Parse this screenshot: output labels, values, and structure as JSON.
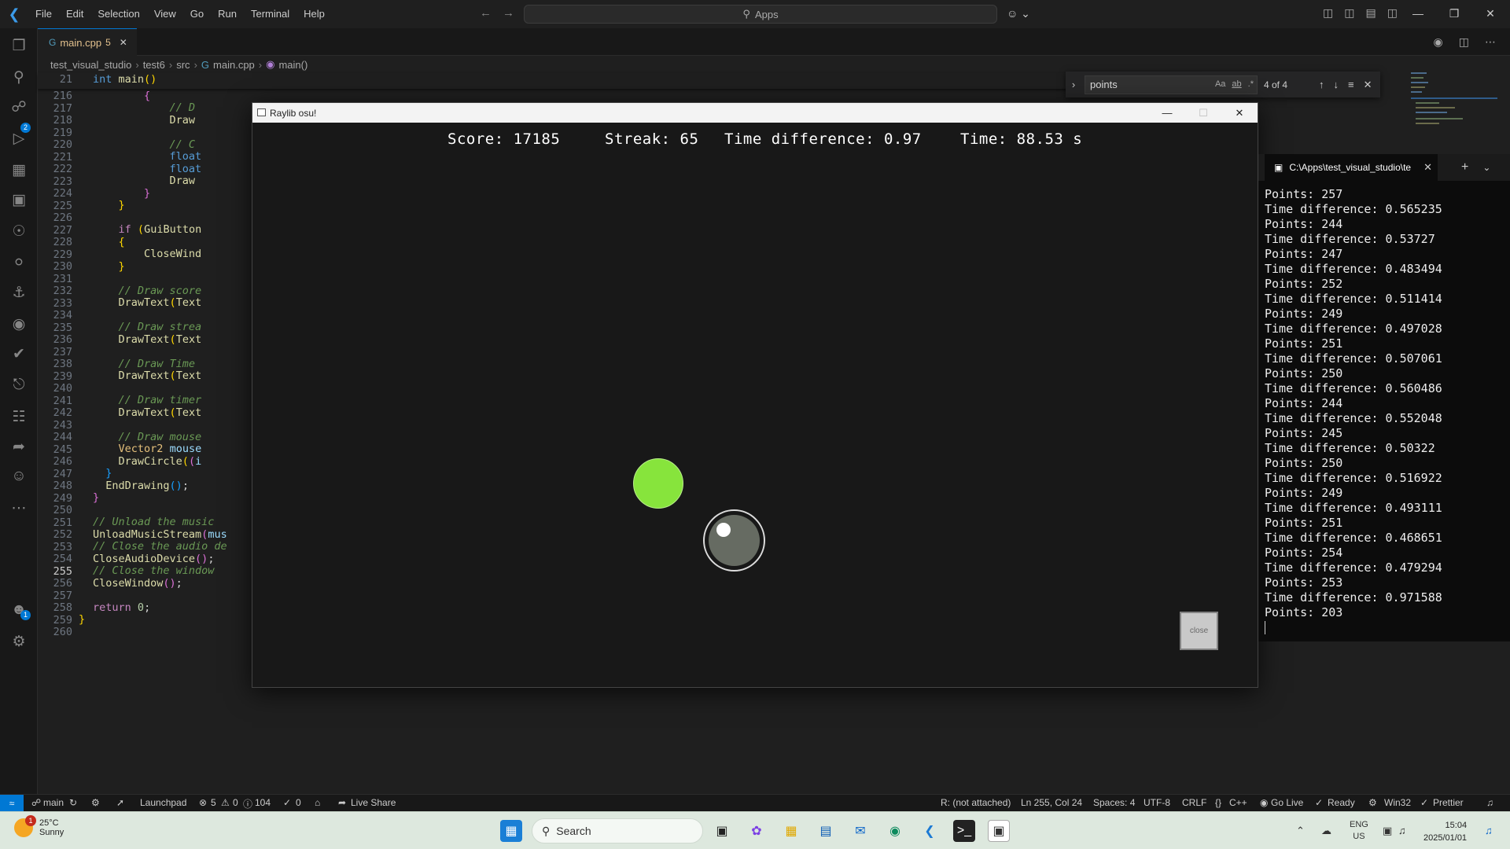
{
  "titlebar": {
    "menu": [
      "File",
      "Edit",
      "Selection",
      "View",
      "Go",
      "Run",
      "Terminal",
      "Help"
    ],
    "search_text": "Apps"
  },
  "activity": {
    "source_control_badge": "2",
    "accounts_badge": "1"
  },
  "tab": {
    "filename": "main.cpp",
    "problems_count": "5"
  },
  "breadcrumb": [
    "test_visual_studio",
    "test6",
    "src",
    "main.cpp",
    "main()"
  ],
  "sticky": {
    "line": "21",
    "code_kw": "int",
    "code_fn": "main",
    "code_rest": "()"
  },
  "editor_lines": [
    "216",
    "217",
    "218",
    "219",
    "220",
    "221",
    "222",
    "223",
    "224",
    "225",
    "226",
    "227",
    "228",
    "229",
    "230",
    "231",
    "232",
    "233",
    "234",
    "235",
    "236",
    "237",
    "238",
    "239",
    "240",
    "241",
    "242",
    "243",
    "244",
    "245",
    "246",
    "247",
    "248",
    "249",
    "250",
    "251",
    "252",
    "253",
    "254",
    "255",
    "256",
    "257",
    "258",
    "259",
    "260"
  ],
  "current_line": "255",
  "find": {
    "query": "points",
    "result": "4 of 4",
    "opt_case": "Aa",
    "opt_word": "ab",
    "opt_regex": ".*"
  },
  "raylib": {
    "title": "Raylib osu!",
    "score": "Score: 17185",
    "streak": "Streak: 65",
    "time_diff": "Time difference: 0.97",
    "time": "Time: 88.53 s",
    "close_label": "close"
  },
  "terminal": {
    "tab_title": "C:\\Apps\\test_visual_studio\\te",
    "lines": [
      "Points: 257",
      "Time difference: 0.565235",
      "Points: 244",
      "Time difference: 0.53727",
      "Points: 247",
      "Time difference: 0.483494",
      "Points: 252",
      "Time difference: 0.511414",
      "Points: 249",
      "Time difference: 0.497028",
      "Points: 251",
      "Time difference: 0.507061",
      "Points: 250",
      "Time difference: 0.560486",
      "Points: 244",
      "Time difference: 0.552048",
      "Points: 245",
      "Time difference: 0.50322",
      "Points: 250",
      "Time difference: 0.516922",
      "Points: 249",
      "Time difference: 0.493111",
      "Points: 251",
      "Time difference: 0.468651",
      "Points: 254",
      "Time difference: 0.479294",
      "Points: 253",
      "Time difference: 0.971588",
      "Points: 203"
    ]
  },
  "status": {
    "branch": "main",
    "launchpad": "Launchpad",
    "problems": "5",
    "warnings": "0",
    "infos": "104",
    "ports": "0",
    "liveshare": "Live Share",
    "r_status": "R: (not attached)",
    "position": "Ln 255, Col 24",
    "spaces": "Spaces: 4",
    "encoding": "UTF-8",
    "eol": "CRLF",
    "language": "C++",
    "golive": "Go Live",
    "ready": "Ready",
    "platform": "Win32",
    "prettier": "Prettier"
  },
  "taskbar": {
    "temp": "25°C",
    "condition": "Sunny",
    "weather_badge": "1",
    "search_placeholder": "Search",
    "lang": "ENG",
    "region": "US",
    "time": "15:04",
    "date": "2025/01/01"
  },
  "colors": {
    "accent": "#0078d4",
    "target_circle": "#87e43c",
    "game_bg": "#181818"
  }
}
